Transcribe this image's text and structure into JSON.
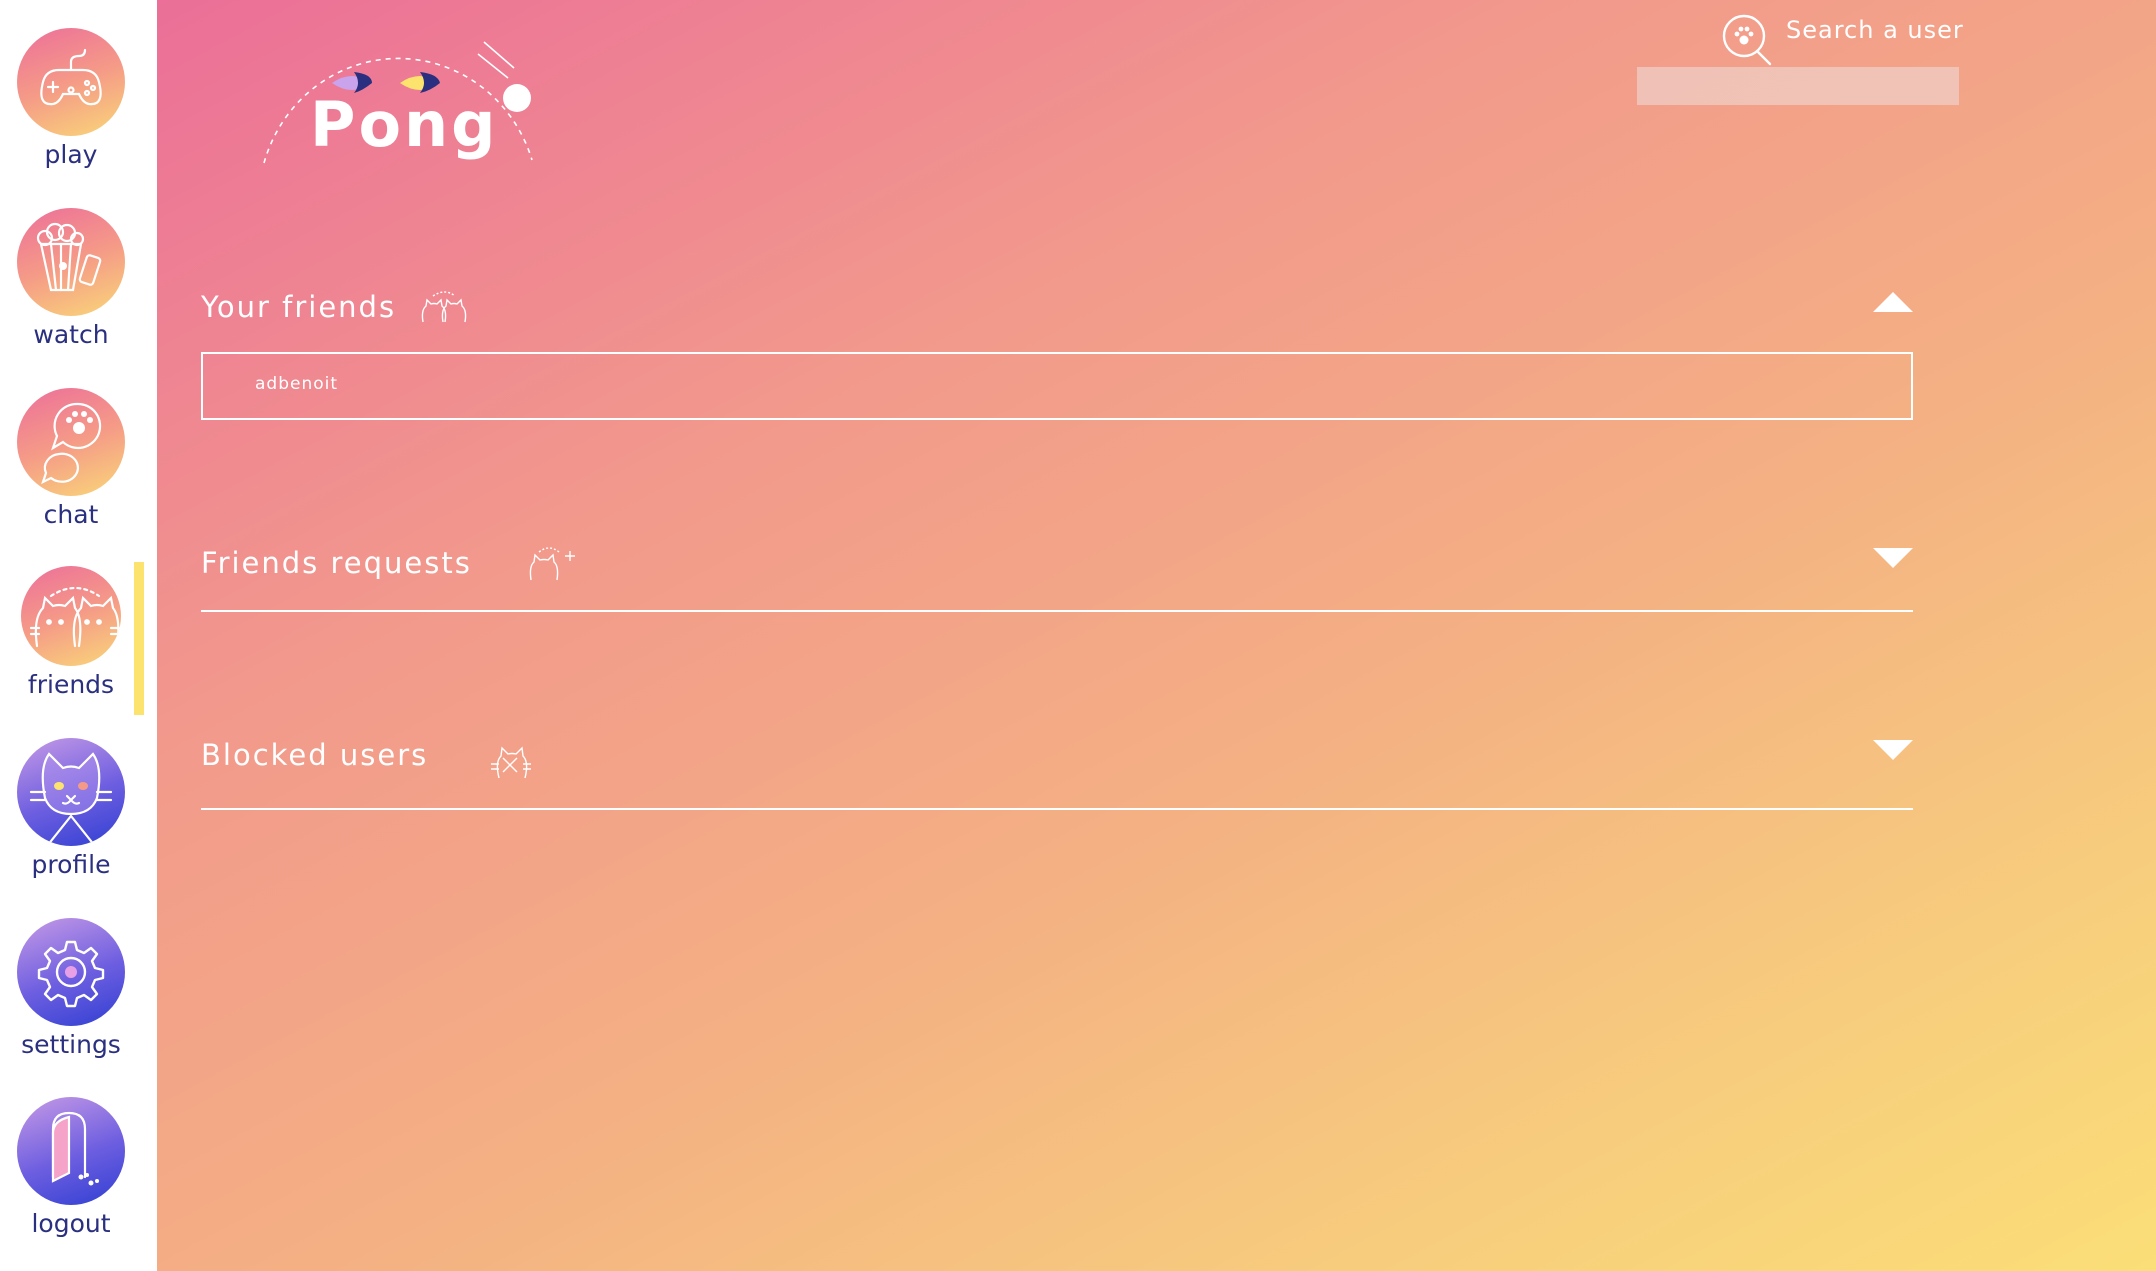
{
  "sidebar": {
    "items": [
      {
        "label": "play",
        "icon": "gamepad-icon"
      },
      {
        "label": "watch",
        "icon": "popcorn-icon"
      },
      {
        "label": "chat",
        "icon": "chat-paw-icon"
      },
      {
        "label": "friends",
        "icon": "two-cats-icon"
      },
      {
        "label": "profile",
        "icon": "cat-face-icon"
      },
      {
        "label": "settings",
        "icon": "gear-icon"
      },
      {
        "label": "logout",
        "icon": "door-icon"
      }
    ],
    "active": "friends"
  },
  "header": {
    "logo_text": "Pong",
    "search_label": "Search a user",
    "search_value": ""
  },
  "sections": {
    "friends": {
      "title": "Your friends",
      "expanded": true,
      "items": [
        "adbenoit"
      ]
    },
    "requests": {
      "title": "Friends requests",
      "expanded": false
    },
    "blocked": {
      "title": "Blocked users",
      "expanded": false
    }
  },
  "colors": {
    "gradient_start": "#eb6f98",
    "gradient_end": "#fbde77",
    "nav_text": "#2a2f7f",
    "active_marker": "#fbe36d",
    "cool_icon": "#2f3fd2"
  }
}
